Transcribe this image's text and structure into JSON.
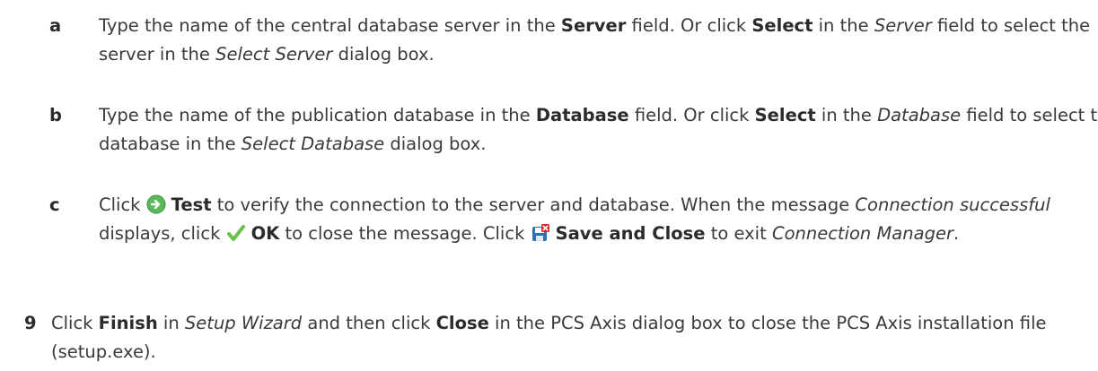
{
  "steps": [
    {
      "marker": "a",
      "parts": [
        {
          "t": "Type the name of the central database server in the "
        },
        {
          "b": "Server"
        },
        {
          "t": " field. Or click "
        },
        {
          "b": "Select"
        },
        {
          "t": " in the "
        },
        {
          "i": "Server"
        },
        {
          "t": " field to select the server in the "
        },
        {
          "i": "Select Server"
        },
        {
          "t": " dialog box."
        }
      ]
    },
    {
      "marker": "b",
      "parts": [
        {
          "t": "Type the name of the publication database in the "
        },
        {
          "b": "Database"
        },
        {
          "t": " field. Or click "
        },
        {
          "b": "Select"
        },
        {
          "t": " in the "
        },
        {
          "i": "Database"
        },
        {
          "t": " field to select the database in the "
        },
        {
          "i": "Select Database"
        },
        {
          "t": " dialog box."
        }
      ]
    },
    {
      "marker": "c",
      "parts": [
        {
          "t": "Click "
        },
        {
          "icon": "test-icon"
        },
        {
          "b": "Test"
        },
        {
          "t": " to verify the connection to the server and database. When the message "
        },
        {
          "i": "Connection successful"
        },
        {
          "t": " displays, click "
        },
        {
          "icon": "ok-checkmark-icon"
        },
        {
          "b": "OK"
        },
        {
          "t": " to close the message. Click "
        },
        {
          "icon": "save-and-close-icon"
        },
        {
          "b": "Save and Close"
        },
        {
          "t": " to exit "
        },
        {
          "i": "Connection Manager"
        },
        {
          "t": "."
        }
      ]
    },
    {
      "marker": "9",
      "parts": [
        {
          "t": "Click "
        },
        {
          "b": "Finish"
        },
        {
          "t": " in "
        },
        {
          "i": "Setup Wizard"
        },
        {
          "t": " and then click "
        },
        {
          "b": "Close"
        },
        {
          "t": " in the PCS Axis dialog box to close the PCS Axis installation file (setup.exe)."
        }
      ]
    }
  ],
  "colors": {
    "text": "#3a3a3a",
    "test_icon": "#5cb85c",
    "ok_icon": "#6cc04a",
    "save_icon_red": "#d9262c",
    "save_icon_blue": "#2f6fb3"
  }
}
